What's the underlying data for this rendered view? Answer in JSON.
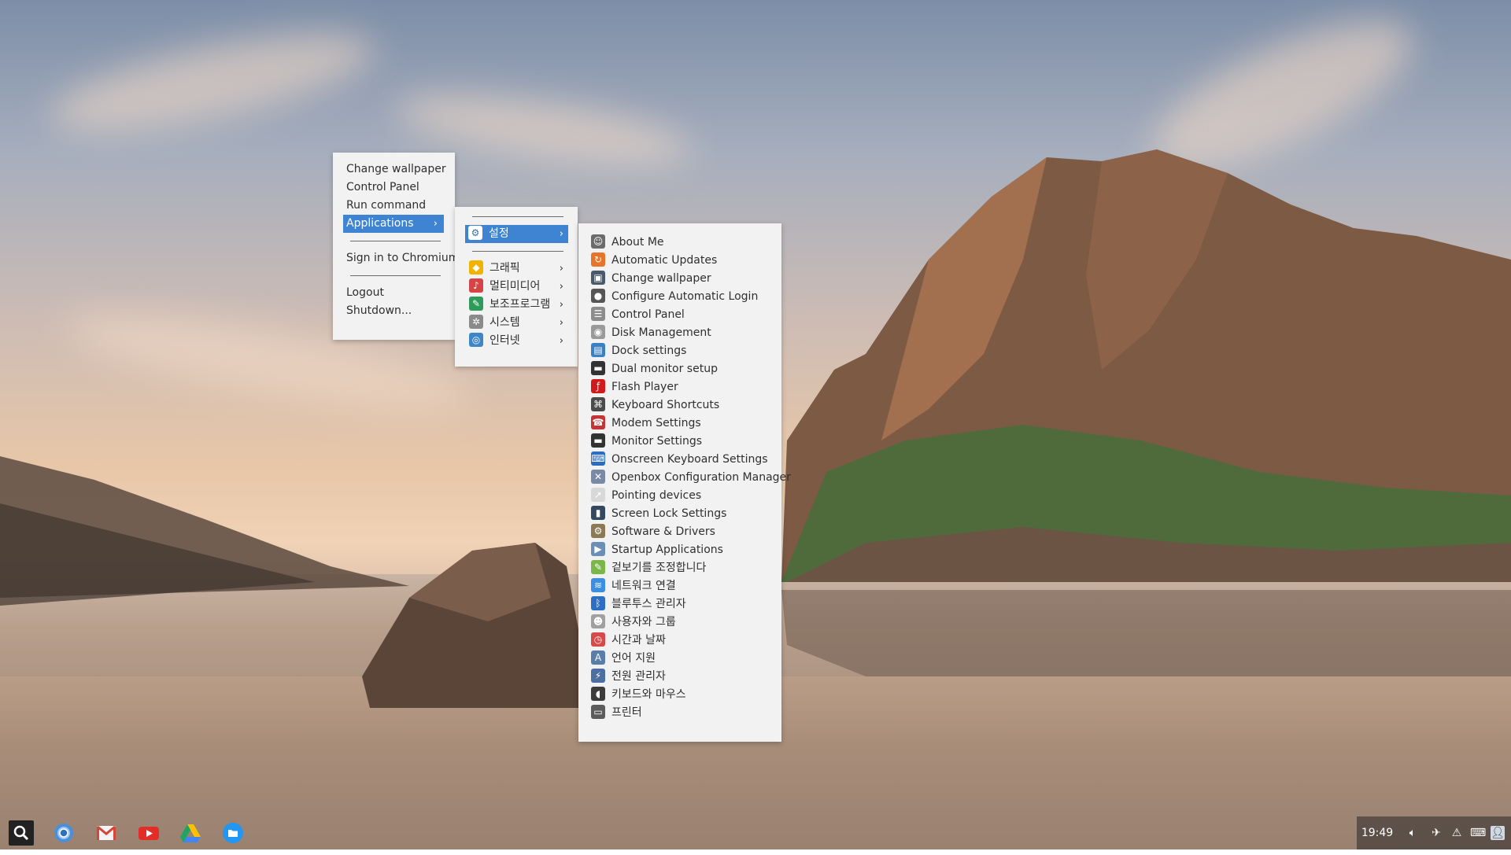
{
  "desktop_menu": {
    "items": [
      {
        "label": "Change wallpaper"
      },
      {
        "label": "Control Panel"
      },
      {
        "label": "Run command"
      },
      {
        "label": "Applications",
        "submenu": true
      },
      {
        "label": "Sign in to Chromium"
      },
      {
        "label": "Logout"
      },
      {
        "label": "Shutdown..."
      }
    ]
  },
  "applications_menu": {
    "items": [
      {
        "label": "설정",
        "icon": "settings-icon",
        "color": "#3a6fb0"
      },
      {
        "label": "그래픽",
        "icon": "graphics-icon",
        "color": "#f0b400"
      },
      {
        "label": "멀티미디어",
        "icon": "multimedia-icon",
        "color": "#d64545"
      },
      {
        "label": "보조프로그램",
        "icon": "accessories-icon",
        "color": "#2e9b5a"
      },
      {
        "label": "시스템",
        "icon": "system-icon",
        "color": "#8a8a8a"
      },
      {
        "label": "인터넷",
        "icon": "internet-icon",
        "color": "#3f86c9"
      }
    ]
  },
  "settings_menu": {
    "items": [
      {
        "label": "About Me",
        "icon": "user-icon",
        "color": "#6b6b6b"
      },
      {
        "label": "Automatic Updates",
        "icon": "update-icon",
        "color": "#e8742a"
      },
      {
        "label": "Change wallpaper",
        "icon": "wallpaper-icon",
        "color": "#4a5a6a"
      },
      {
        "label": "Configure Automatic Login",
        "icon": "login-icon",
        "color": "#555555"
      },
      {
        "label": "Control Panel",
        "icon": "control-panel-icon",
        "color": "#8c8c8c"
      },
      {
        "label": "Disk Management",
        "icon": "disk-icon",
        "color": "#9a9a9a"
      },
      {
        "label": "Dock settings",
        "icon": "dock-icon",
        "color": "#3b7fc4"
      },
      {
        "label": "Dual monitor setup",
        "icon": "monitor-icon",
        "color": "#333333"
      },
      {
        "label": "Flash Player",
        "icon": "flash-icon",
        "color": "#d11a1a"
      },
      {
        "label": "Keyboard Shortcuts",
        "icon": "keyboard-shortcuts-icon",
        "color": "#4b4b4b"
      },
      {
        "label": "Modem Settings",
        "icon": "modem-icon",
        "color": "#c43434"
      },
      {
        "label": "Monitor Settings",
        "icon": "monitor-settings-icon",
        "color": "#333333"
      },
      {
        "label": "Onscreen Keyboard Settings",
        "icon": "onscreen-keyboard-icon",
        "color": "#2e6cc0"
      },
      {
        "label": "Openbox Configuration Manager",
        "icon": "openbox-icon",
        "color": "#7a8aa6"
      },
      {
        "label": "Pointing devices",
        "icon": "pointer-icon",
        "color": "#d8d8d8"
      },
      {
        "label": "Screen Lock Settings",
        "icon": "screen-lock-icon",
        "color": "#34495e"
      },
      {
        "label": "Software & Drivers",
        "icon": "software-icon",
        "color": "#8c7a55"
      },
      {
        "label": "Startup Applications",
        "icon": "startup-icon",
        "color": "#6b8fb5"
      },
      {
        "label": "겉보기를 조정합니다",
        "icon": "appearance-icon",
        "color": "#7ab648"
      },
      {
        "label": "네트워크 연결",
        "icon": "network-icon",
        "color": "#3a8ee6"
      },
      {
        "label": "블루투스 관리자",
        "icon": "bluetooth-icon",
        "color": "#2d6fc2"
      },
      {
        "label": "사용자와 그룹",
        "icon": "users-groups-icon",
        "color": "#a0a0a0"
      },
      {
        "label": "시간과 날짜",
        "icon": "clock-icon",
        "color": "#d64a4a"
      },
      {
        "label": "언어 지원",
        "icon": "language-icon",
        "color": "#5b7ea8"
      },
      {
        "label": "전원 관리자",
        "icon": "power-icon",
        "color": "#4a6fa0"
      },
      {
        "label": "키보드와 마우스",
        "icon": "mouse-icon",
        "color": "#3c3c3c"
      },
      {
        "label": "프린터",
        "icon": "printer-icon",
        "color": "#5c5c5c"
      }
    ]
  },
  "shelf": {
    "apps": [
      {
        "name": "chromium",
        "color": "#4a90d9"
      },
      {
        "name": "gmail",
        "color": "#d44638"
      },
      {
        "name": "youtube",
        "color": "#e52d27"
      },
      {
        "name": "google-drive",
        "color": "#1fa463"
      },
      {
        "name": "files",
        "color": "#2196f3"
      }
    ]
  },
  "tray": {
    "clock": "19:49"
  },
  "colors": {
    "menu_bg": "#f2f2f2",
    "selection": "#3e84d3"
  }
}
